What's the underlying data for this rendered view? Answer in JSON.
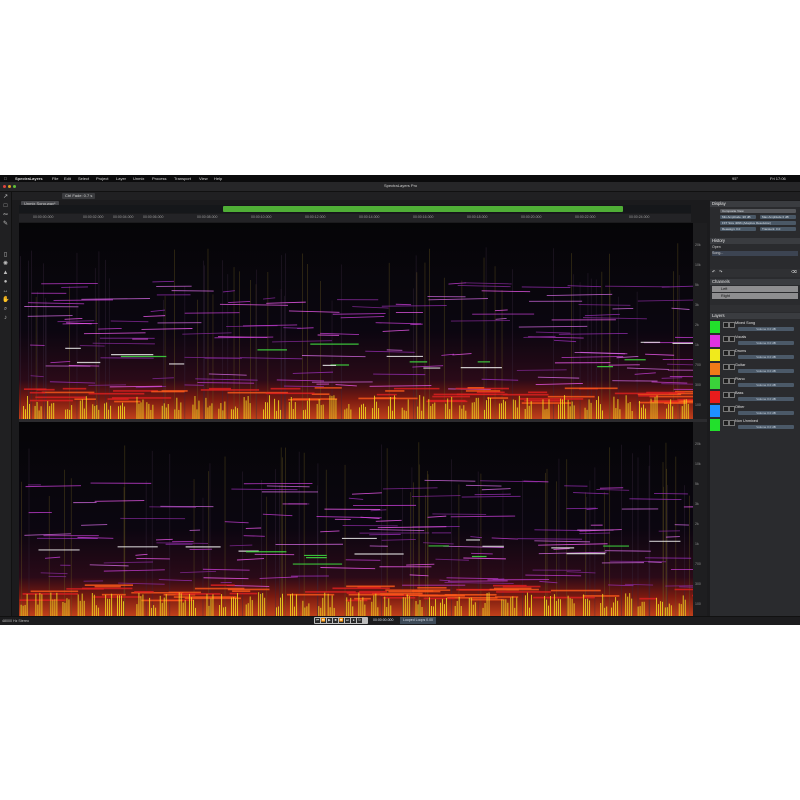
{
  "app": {
    "name": "SpectraLayers",
    "window_title": "SpectraLayers Pro",
    "menu": [
      "File",
      "Edit",
      "Select",
      "Project",
      "Layer",
      "Unmix",
      "Process",
      "Transport",
      "View",
      "Help"
    ],
    "status_right": "95°",
    "clock_right": "Fri 17:06"
  },
  "tabs": [
    {
      "label": "Unmix Song.wav*"
    }
  ],
  "toolbar": {
    "fade_label": "Ctrl Fade: 0.7 s"
  },
  "ruler": {
    "ticks": [
      "00:00:00.000",
      "00:00:02.000",
      "00:00:04.000",
      "00:00:06.000",
      "00:00:08.000",
      "00:00:10.000",
      "00:00:12.000",
      "00:00:14.000",
      "00:00:16.000",
      "00:00:18.000",
      "00:00:20.000",
      "00:00:22.000",
      "00:00:24.000",
      "00:00:26.000"
    ]
  },
  "freq_axis": {
    "ticks": [
      "20k",
      "15k",
      "10k",
      "7k",
      "5k",
      "3k",
      "2k",
      "1k",
      "700",
      "500",
      "300",
      "200",
      "100"
    ]
  },
  "panels": {
    "display": {
      "title": "Display",
      "mode": "Composite View",
      "min_amp_label": "Min Amplitude -96 dB",
      "max_amp_label": "Max Amplitude 0 dB",
      "fft_label": "FFT Size 4096 (Adaptive Resolution)",
      "reassign_label": "Reassign: 0.0",
      "transient_label": "Transient: 0.0"
    },
    "history": {
      "title": "History",
      "items": [
        "Open",
        "Song..."
      ]
    },
    "channels": {
      "title": "Channels",
      "items": [
        "Left",
        "Right"
      ]
    },
    "layers": {
      "title": "Layers",
      "items": [
        {
          "name": "Mixed Song",
          "volume": "Volume 0.0 dB",
          "color": "#22e02c"
        },
        {
          "name": "Vocals",
          "volume": "Volume 0.0 dB",
          "color": "#e032e0"
        },
        {
          "name": "Drums",
          "volume": "Volume 0.0 dB",
          "color": "#f0ea1c"
        },
        {
          "name": "Guitar",
          "volume": "Volume 0.0 dB",
          "color": "#f07a18"
        },
        {
          "name": "Piano",
          "volume": "Volume 0.0 dB",
          "color": "#3ad23a"
        },
        {
          "name": "Bass",
          "volume": "Volume 0.0 dB",
          "color": "#e81c1c"
        },
        {
          "name": "Other",
          "volume": "Volume 0.0 dB",
          "color": "#1e90ff"
        },
        {
          "name": "Non Unmixed",
          "volume": "Volume 0.0 dB",
          "color": "#22e02c"
        }
      ]
    }
  },
  "statusbar": {
    "left": "48000 Hz Stereo",
    "time": "00:00:00.000",
    "selection": "Looped Loops 0.00"
  },
  "colors": {
    "accent_green": "#4fae36",
    "panel_bg": "#2a2b2e",
    "spectrogram_bg": "#060608"
  }
}
